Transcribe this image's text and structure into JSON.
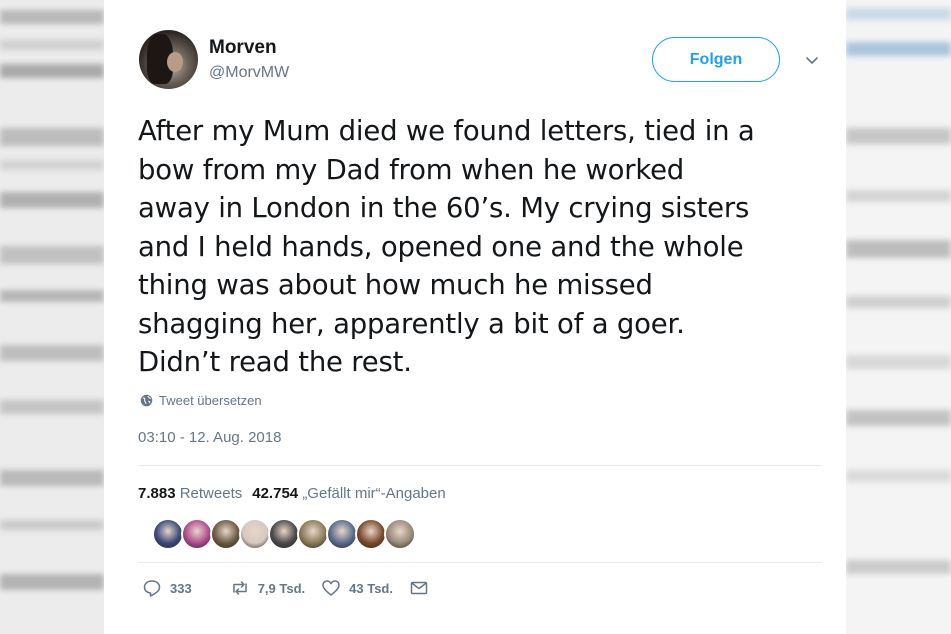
{
  "author": {
    "display_name": "Morven",
    "handle": "@MorvMW"
  },
  "follow_button": {
    "label": "Folgen"
  },
  "tweet": {
    "lines": [
      "After my Mum died we found letters, tied in a",
      "bow from my Dad from when he worked",
      "away in London in the 60’s. My crying sisters",
      "and I held hands, opened one and the whole",
      "thing was about how much he missed",
      "shagging her, apparently a bit of a goer.",
      "Didn’t read the rest."
    ],
    "translate_label": "Tweet übersetzen",
    "timestamp": "03:10 - 12. Aug. 2018"
  },
  "stats": {
    "retweets_count": "7.883",
    "retweets_label": "Retweets",
    "likes_count": "42.754",
    "likes_label": "„Gefällt mir“-Angaben"
  },
  "likers": [
    {
      "icon": "liker-avatar",
      "color": "#3a4a7a"
    },
    {
      "icon": "liker-avatar",
      "color": "#b04a8e"
    },
    {
      "icon": "liker-avatar",
      "color": "#6b5a45"
    },
    {
      "icon": "liker-avatar",
      "color": "#d8c8c0"
    },
    {
      "icon": "liker-avatar",
      "color": "#4a4a4a"
    },
    {
      "icon": "liker-avatar",
      "color": "#8a7a5a"
    },
    {
      "icon": "liker-avatar",
      "color": "#5a6a8a"
    },
    {
      "icon": "liker-avatar",
      "color": "#7a4a2a"
    },
    {
      "icon": "liker-avatar",
      "color": "#9a8a7a"
    }
  ],
  "actions": {
    "replies": "333",
    "retweets": "7,9 Tsd.",
    "likes": "43 Tsd."
  },
  "colors": {
    "accent": "#1da1f2",
    "secondary_text": "#657786",
    "primary_text": "#14171a",
    "divider": "#e6ecf0"
  }
}
